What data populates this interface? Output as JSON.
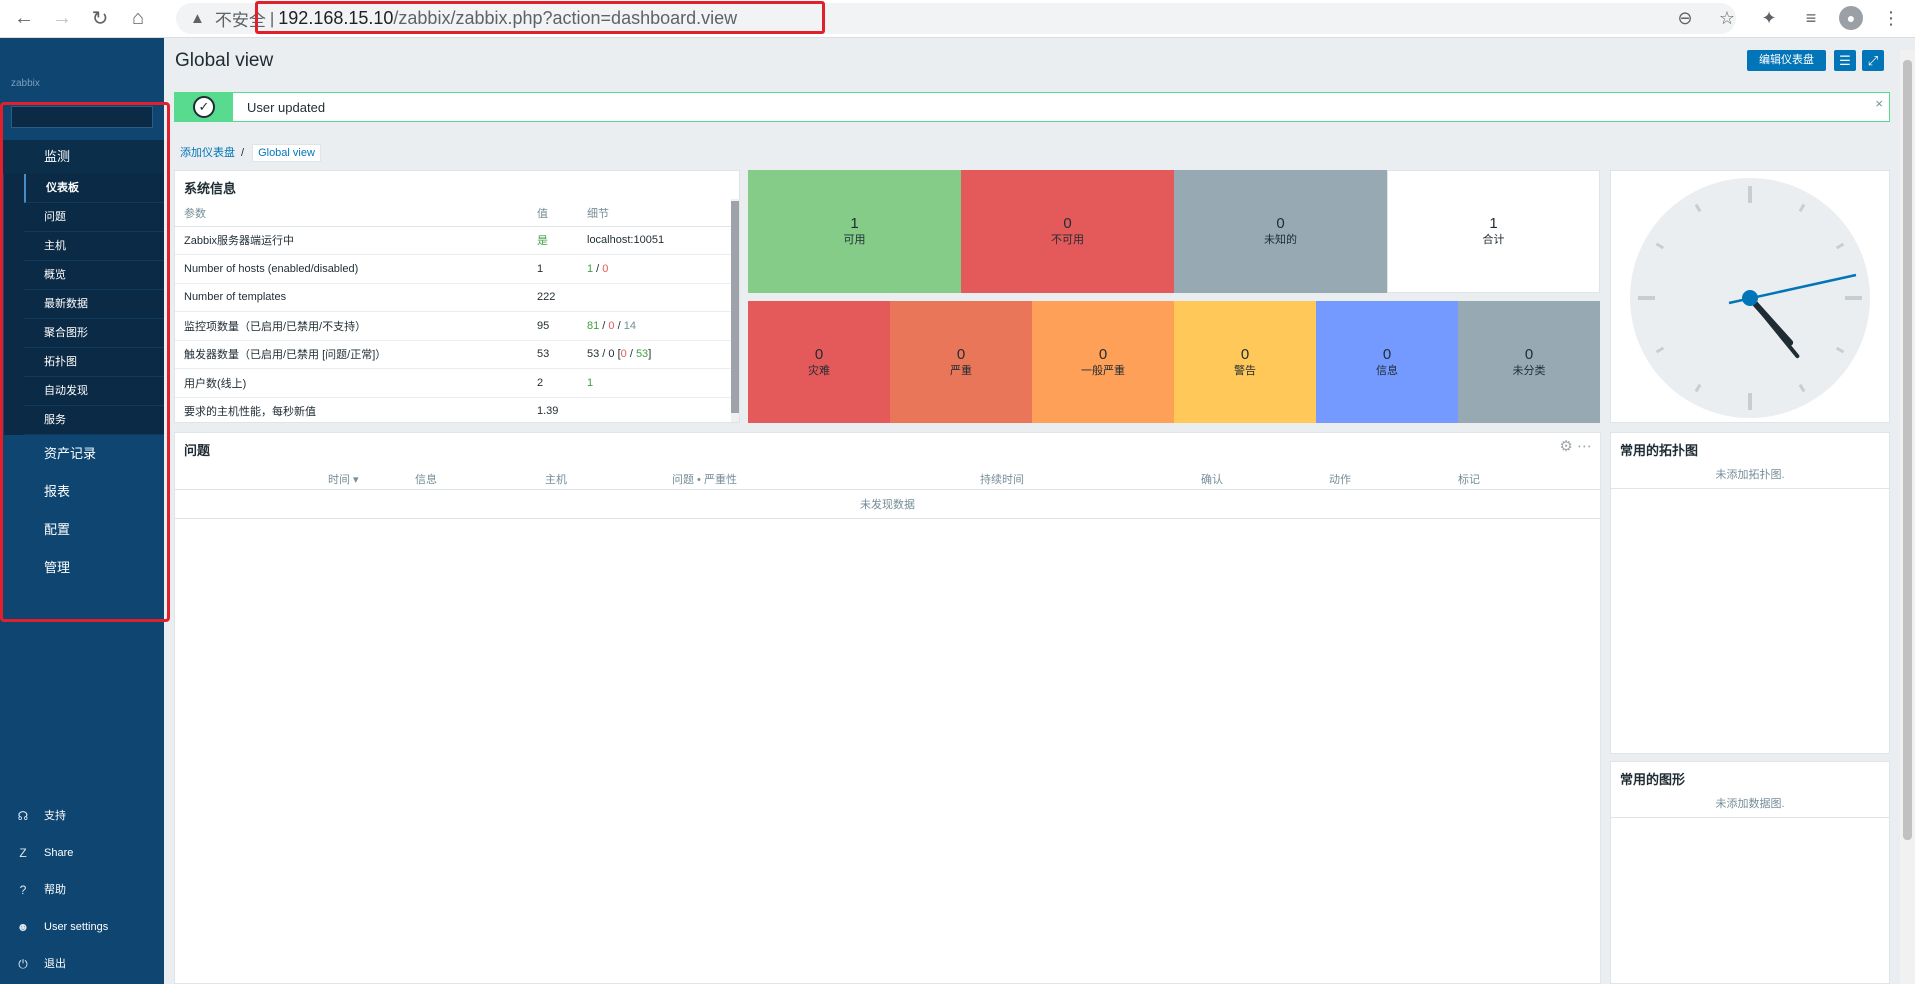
{
  "browser": {
    "insecure_label": "不安全",
    "url_host": "192.168.15.10",
    "url_path": "/zabbix/zabbix.php?action=dashboard.view"
  },
  "sidebar": {
    "logo": "zabbix",
    "monitoring": "监测",
    "sub_items": [
      "仪表板",
      "问题",
      "主机",
      "概览",
      "最新数据",
      "聚合图形",
      "拓扑图",
      "自动发现",
      "服务"
    ],
    "main_items": [
      "资产记录",
      "报表",
      "配置",
      "管理"
    ],
    "bottom": [
      {
        "icon": "headset-icon",
        "label": "支持"
      },
      {
        "icon": "share-icon",
        "label": "Share"
      },
      {
        "icon": "help-icon",
        "label": "帮助"
      },
      {
        "icon": "user-icon",
        "label": "User settings"
      },
      {
        "icon": "power-icon",
        "label": "退出"
      }
    ]
  },
  "header": {
    "title": "Global view",
    "edit_label": "编辑仪表盘"
  },
  "message": {
    "text": "User updated"
  },
  "breadcrumb": {
    "parent": "添加仪表盘",
    "current": "Global view"
  },
  "sysinfo": {
    "title": "系统信息",
    "cols": [
      "参数",
      "值",
      "细节"
    ],
    "rows": [
      {
        "param": "Zabbix服务器端运行中",
        "value": "是",
        "detail": "localhost:10051"
      },
      {
        "param": "Number of hosts (enabled/disabled)",
        "value": "1",
        "d1": "1",
        "d2": "0"
      },
      {
        "param": "Number of templates",
        "value": "222"
      },
      {
        "param": "监控项数量（已启用/已禁用/不支持）",
        "value": "95",
        "d1": "81",
        "d2": "0",
        "d3": "14"
      },
      {
        "param": "触发器数量（已启用/已禁用 [问题/正常]）",
        "value": "53",
        "pre": "53 / 0 [",
        "d2": "0",
        "d1": "53",
        "post": "]"
      },
      {
        "param": "用户数(线上)",
        "value": "2",
        "d1": "1"
      },
      {
        "param": "要求的主机性能，每秒新值",
        "value": "1.39"
      }
    ]
  },
  "host_avail": [
    {
      "count": "1",
      "label": "可用",
      "color": "#86cc89"
    },
    {
      "count": "0",
      "label": "不可用",
      "color": "#e45959"
    },
    {
      "count": "0",
      "label": "未知的",
      "color": "#97aab3"
    },
    {
      "count": "1",
      "label": "合计",
      "color": "#ffffff"
    }
  ],
  "severity": [
    {
      "count": "0",
      "label": "灾难",
      "color": "#e45959"
    },
    {
      "count": "0",
      "label": "严重",
      "color": "#e97659"
    },
    {
      "count": "0",
      "label": "一般严重",
      "color": "#ffa059"
    },
    {
      "count": "0",
      "label": "警告",
      "color": "#ffc859"
    },
    {
      "count": "0",
      "label": "信息",
      "color": "#7499ff"
    },
    {
      "count": "0",
      "label": "未分类",
      "color": "#97aab3"
    }
  ],
  "problems": {
    "title": "问题",
    "cols": [
      "时间 ▾",
      "信息",
      "主机",
      "问题 • 严重性",
      "持续时间",
      "确认",
      "动作",
      "标记"
    ],
    "empty": "未发现数据"
  },
  "fav_maps": {
    "title": "常用的拓扑图",
    "empty": "未添加拓扑图."
  },
  "fav_graphs": {
    "title": "常用的图形",
    "empty": "未添加数据图."
  },
  "clock": {
    "hour": 4.6,
    "minute": 18
  }
}
